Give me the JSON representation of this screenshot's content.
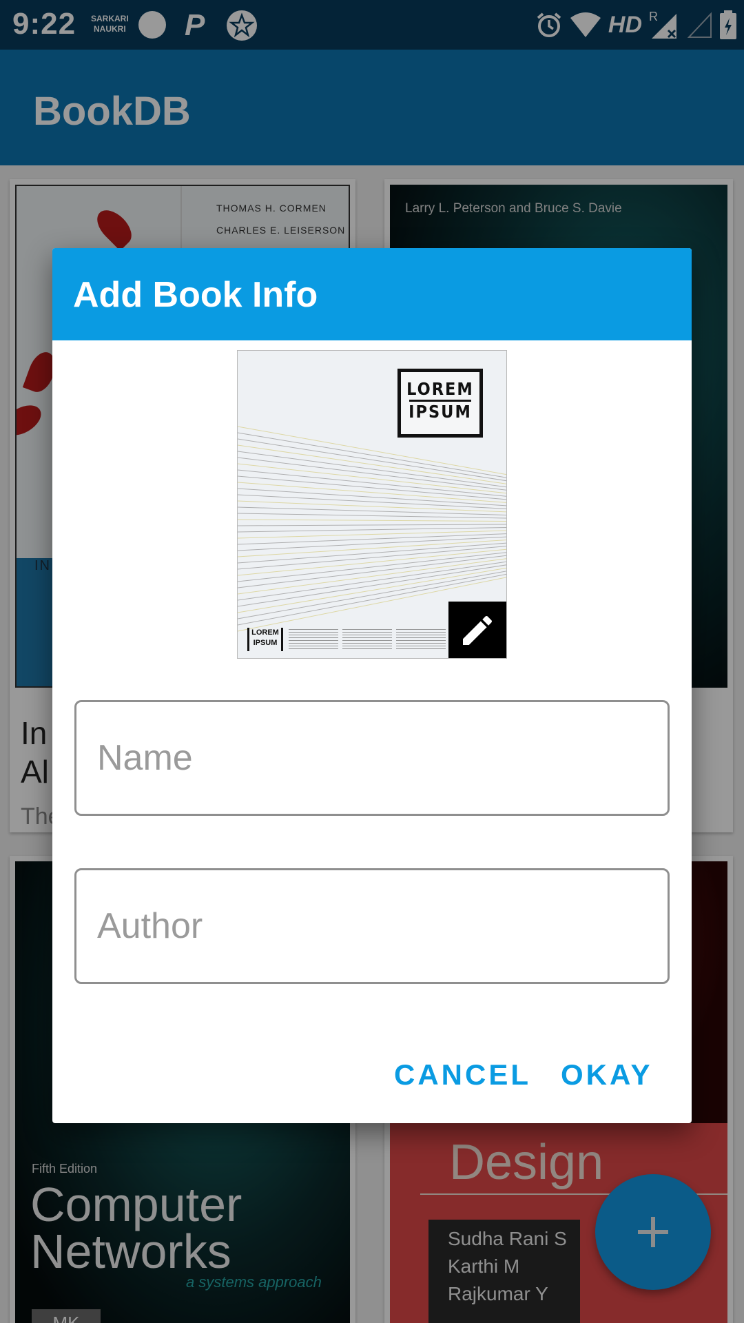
{
  "status_bar": {
    "time": "9:22",
    "mini_label_1": "SARKARI",
    "mini_label_2": "NAUKRI",
    "p_label": "P",
    "hd_label": "HD",
    "roaming": "R"
  },
  "app_bar": {
    "title": "BookDB",
    "color": "#0d75b1"
  },
  "books": [
    {
      "cover_author_line_1": "THOMAS H. CORMEN",
      "cover_author_line_2": "CHARLES E. LEISERSON",
      "cover_text": "IN",
      "title_partial_line_1": "In",
      "title_partial_line_2": "Al",
      "author_partial": "The"
    },
    {
      "cover_author": "Larry L. Peterson and Bruce S. Davie"
    },
    {
      "cover_edition": "Fifth Edition",
      "cover_title_line_1": "Computer",
      "cover_title_line_2": "Networks",
      "cover_subtitle": "a systems approach",
      "publisher": "MK"
    },
    {
      "cover_title": "Design",
      "cover_authors": [
        "Sudha Rani S",
        "Karthi M",
        "Rajkumar Y"
      ]
    }
  ],
  "dialog": {
    "title": "Add Book Info",
    "header_color": "#0a9be2",
    "cover": {
      "logo_line_1": "LOREM",
      "logo_line_2": "IPSUM",
      "small_logo_line_1": "LOREM",
      "small_logo_line_2": "IPSUM"
    },
    "edit_icon": "pencil-icon",
    "name_field": {
      "value": "",
      "placeholder": "Name"
    },
    "author_field": {
      "value": "",
      "placeholder": "Author"
    },
    "cancel_label": "CANCEL",
    "okay_label": "OKAY"
  },
  "fab": {
    "icon": "plus-icon"
  }
}
